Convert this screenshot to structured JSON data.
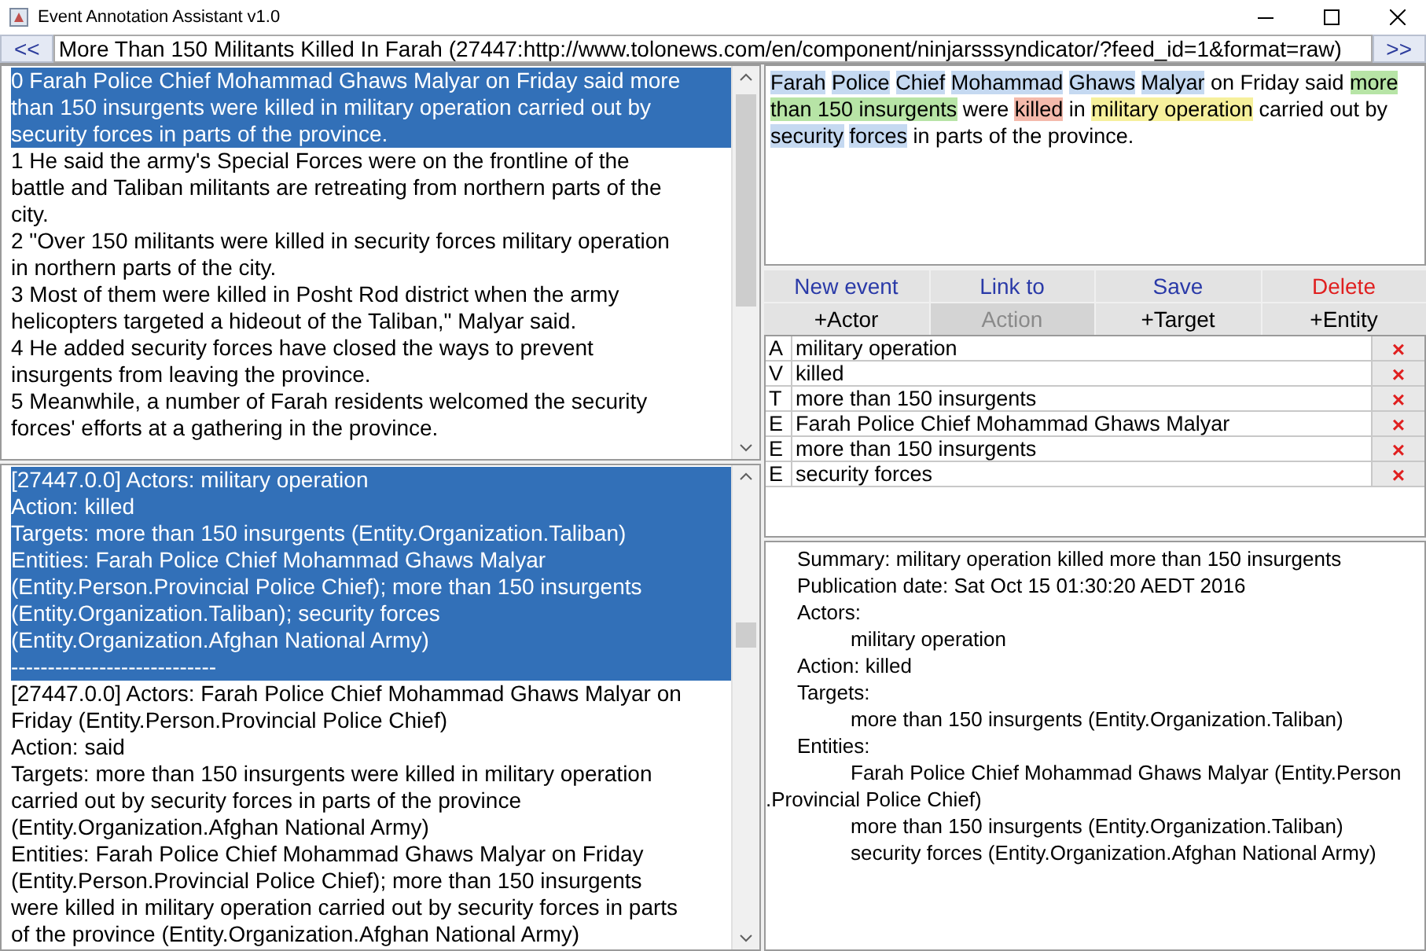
{
  "window": {
    "title": "Event Annotation Assistant v1.0"
  },
  "navigation": {
    "previous": "<<",
    "document_title": "More Than 150 Militants Killed In Farah (27447:http://www.tolonews.com/en/component/ninjarsssyndicator/?feed_id=1&format=raw)",
    "next": ">>"
  },
  "sentences": [
    {
      "text": "0 Farah Police Chief Mohammad Ghaws Malyar on Friday said more than 150 insurgents were killed in military operation carried out by security forces in parts of the province.",
      "selected": true
    },
    {
      "text": "1 He said the army's Special Forces were on the frontline of the battle and Taliban militants are retreating from northern parts of the city.",
      "selected": false
    },
    {
      "text": "2 \"Over 150 militants were killed in security forces military operation in northern parts of the city.",
      "selected": false
    },
    {
      "text": "3 Most of them were killed in Posht Rod district when the army helicopters targeted a hideout of the Taliban,\" Malyar said.",
      "selected": false
    },
    {
      "text": "4 He added security forces have closed the ways to prevent insurgents from leaving the province.",
      "selected": false
    },
    {
      "text": "5 Meanwhile, a number of Farah residents welcomed the security forces' efforts at a gathering in the province.",
      "selected": false
    }
  ],
  "annotated_sentence": [
    {
      "text": "Farah",
      "color": "#c5d9f1"
    },
    {
      "text": "Police",
      "color": "#c5d9f1"
    },
    {
      "text": "Chief",
      "color": "#c5d9f1"
    },
    {
      "text": "Mohammad",
      "color": "#c5d9f1"
    },
    {
      "text": "Ghaws",
      "color": "#c5d9f1"
    },
    {
      "text": "Malyar",
      "color": "#c5d9f1"
    },
    {
      "text": " on Friday said "
    },
    {
      "text": "more than 150 insurgents",
      "color": "#b7e4a6"
    },
    {
      "text": " were "
    },
    {
      "text": "killed",
      "color": "#f4b9ab"
    },
    {
      "text": " in "
    },
    {
      "text": "military operation",
      "color": "#f6f09c"
    },
    {
      "text": " carried out by "
    },
    {
      "text": "security",
      "color": "#c5d9f1"
    },
    {
      "text": "forces",
      "color": "#c5d9f1"
    },
    {
      "text": " in parts of the province."
    }
  ],
  "buttons": [
    {
      "label": "New event",
      "kind": "blue",
      "disabled": false
    },
    {
      "label": "Link to",
      "kind": "blue",
      "disabled": false
    },
    {
      "label": "Save",
      "kind": "blue",
      "disabled": false
    },
    {
      "label": "Delete",
      "kind": "red",
      "disabled": false
    },
    {
      "label": "+Actor",
      "kind": "plain",
      "disabled": false
    },
    {
      "label": "Action",
      "kind": "plain",
      "disabled": true
    },
    {
      "label": "+Target",
      "kind": "plain",
      "disabled": false
    },
    {
      "label": "+Entity",
      "kind": "plain",
      "disabled": false
    }
  ],
  "roles": [
    {
      "type": "A",
      "text": "military operation",
      "remove": "×"
    },
    {
      "type": "V",
      "text": "killed",
      "remove": "×"
    },
    {
      "type": "T",
      "text": "more than 150 insurgents",
      "remove": "×"
    },
    {
      "type": "E",
      "text": "Farah Police Chief Mohammad Ghaws Malyar",
      "remove": "×"
    },
    {
      "type": "E",
      "text": "more than 150 insurgents",
      "remove": "×"
    },
    {
      "type": "E",
      "text": "security forces",
      "remove": "×"
    }
  ],
  "events": [
    {
      "selected": true,
      "lines": [
        "[27447.0.0] Actors: military operation",
        "Action: killed",
        "Targets: more than 150 insurgents (Entity.Organization.Taliban)",
        "Entities: Farah Police Chief Mohammad Ghaws Malyar (Entity.Person.Provincial Police Chief); more than 150 insurgents (Entity.Organization.Taliban); security forces (Entity.Organization.Afghan National Army)",
        "----------------------------"
      ]
    },
    {
      "selected": false,
      "lines": [
        "[27447.0.0] Actors: Farah Police Chief Mohammad Ghaws Malyar on Friday (Entity.Person.Provincial Police Chief)",
        "Action: said",
        "Targets: more than 150 insurgents were killed in military operation carried out by security forces in parts of the province (Entity.Organization.Afghan National Army)",
        "Entities: Farah Police Chief Mohammad Ghaws Malyar on Friday (Entity.Person.Provincial Police Chief); more than 150 insurgents were killed in military operation carried out by security forces in parts of the province (Entity.Organization.Afghan National Army)"
      ]
    }
  ],
  "summary": [
    {
      "text": "Summary: military operation killed more than 150 insurgents",
      "kind": "field"
    },
    {
      "text": "Publication date: Sat Oct 15 01:30:20 AEDT 2016",
      "kind": "field"
    },
    {
      "text": "Actors:",
      "kind": "field"
    },
    {
      "text": "military operation",
      "kind": "item"
    },
    {
      "text": "Action: killed",
      "kind": "field"
    },
    {
      "text": "Targets:",
      "kind": "field"
    },
    {
      "text": "more than 150 insurgents (Entity.Organization.Taliban)",
      "kind": "item"
    },
    {
      "text": "Entities:",
      "kind": "field"
    },
    {
      "text": "Farah Police Chief Mohammad Ghaws Malyar (Entity.Person",
      "kind": "item"
    },
    {
      "text": ".Provincial Police Chief)",
      "kind": "wrap"
    },
    {
      "text": "more than 150 insurgents (Entity.Organization.Taliban)",
      "kind": "item"
    },
    {
      "text": "security forces (Entity.Organization.Afghan National Army)",
      "kind": "item"
    }
  ]
}
